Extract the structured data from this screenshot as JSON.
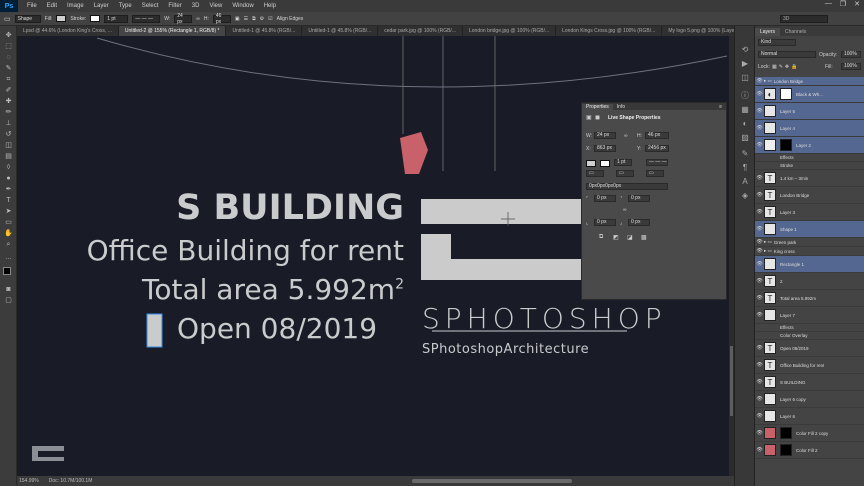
{
  "menubar": {
    "logo": "Ps",
    "items": [
      "File",
      "Edit",
      "Image",
      "Layer",
      "Type",
      "Select",
      "Filter",
      "3D",
      "View",
      "Window",
      "Help"
    ],
    "window_controls": [
      "—",
      "❐",
      "✕"
    ]
  },
  "options": {
    "tool": "Shape",
    "fill_label": "Fill:",
    "stroke_label": "Stroke:",
    "stroke_width": "1 pt",
    "w_label": "W:",
    "w_value": "24 px",
    "h_label": "H:",
    "h_value": "46 px",
    "align_edges": "Align Edges",
    "workspace": "3D",
    "fill_color": "#cfcfcf",
    "stroke_color": "#ffffff"
  },
  "tabs": [
    {
      "label": "Lpsd @ 44.6% (London King's Cross, ...",
      "active": false
    },
    {
      "label": "Untitled-2 @ 155% (Rectangle 1, RGB/8) *",
      "active": true
    },
    {
      "label": "Untitled-1 @ 45.8% (RGB/...",
      "active": false
    },
    {
      "label": "Untitled-1 @ 45.8% (RGB/...",
      "active": false
    },
    {
      "label": "cedar park.jpg @ 100% (RGB/...",
      "active": false
    },
    {
      "label": "London bridge.jpg @ 100% (RGB/...",
      "active": false
    },
    {
      "label": "London Kings Cross.jpg @ 100% (RGB/...",
      "active": false
    },
    {
      "label": "My logo 5.png @ 100% (Layer 0, RGB/...",
      "active": false
    }
  ],
  "canvas": {
    "title": "S BUILDING",
    "subtitle": "Office Building for rent",
    "area_text": "Total area 5.992m",
    "area_sup": "2",
    "open_text": "Open 08/2019",
    "logo_name": "SPHOTOSHOP",
    "logo_tagline": "SPhotoshopArchitecture",
    "accent": "#c9616b",
    "bg": "#191b27"
  },
  "status": {
    "zoom": "154.99%",
    "doc": "Doc: 10.7M/100.1M"
  },
  "properties": {
    "tabs": [
      "Properties",
      "Info"
    ],
    "title": "Live Shape Properties",
    "w_label": "W:",
    "w": "24 px",
    "h_label": "H:",
    "h": "46 px",
    "x_label": "X:",
    "x": "863 px",
    "y_label": "Y:",
    "y": "2456 px",
    "stroke_width": "1 pt",
    "corner_all": "0px0px0px0px",
    "corners": [
      "0 px",
      "0 px",
      "0 px",
      "0 px"
    ]
  },
  "layers_panel": {
    "tabs": [
      "Layers",
      "Channels"
    ],
    "filter": "Kind",
    "blend_mode": "Normal",
    "opacity_label": "Opacity:",
    "opacity": "100%",
    "lock_label": "Lock:",
    "fill_label": "Fill:",
    "fill": "100%",
    "rows": [
      {
        "label": "London Bridge",
        "type": "group",
        "selected": true
      },
      {
        "label": "Black & Wh...",
        "type": "adj",
        "selected": true
      },
      {
        "label": "Layer 5",
        "type": "pixel",
        "selected": true
      },
      {
        "label": "Layer 4",
        "type": "pixel",
        "selected": true
      },
      {
        "label": "Layer 2",
        "type": "mask",
        "selected": true
      },
      {
        "label": "Effects",
        "type": "fx",
        "selected": false
      },
      {
        "label": "Stroke",
        "type": "fx",
        "selected": false
      },
      {
        "label": "1.4 km – 3min",
        "type": "text",
        "selected": false
      },
      {
        "label": "London Bridge",
        "type": "text",
        "selected": false
      },
      {
        "label": "Layer 3",
        "type": "text",
        "selected": false
      },
      {
        "label": "Shape 1",
        "type": "shape",
        "selected": true
      },
      {
        "label": "Green park",
        "type": "group",
        "selected": false
      },
      {
        "label": "King cross",
        "type": "group",
        "selected": false
      },
      {
        "label": "Rectangle 1",
        "type": "shape",
        "selected": true
      },
      {
        "label": "2",
        "type": "text",
        "selected": false
      },
      {
        "label": "Total area 5.992m",
        "type": "text",
        "selected": false
      },
      {
        "label": "Layer 7",
        "type": "pixel",
        "selected": false
      },
      {
        "label": "Effects",
        "type": "fx",
        "selected": false
      },
      {
        "label": "Color Overlay",
        "type": "fx",
        "selected": false
      },
      {
        "label": "Open 08/2019",
        "type": "text",
        "selected": false
      },
      {
        "label": "Office Building for rent",
        "type": "text",
        "selected": false
      },
      {
        "label": "S BUILDING",
        "type": "text",
        "selected": false
      },
      {
        "label": "Layer 6 copy",
        "type": "pixel",
        "selected": false
      },
      {
        "label": "Layer 6",
        "type": "pixel",
        "selected": false
      },
      {
        "label": "Color Fill 2 copy",
        "type": "fill",
        "selected": false
      },
      {
        "label": "Color Fill 2",
        "type": "fill",
        "selected": false
      }
    ]
  }
}
